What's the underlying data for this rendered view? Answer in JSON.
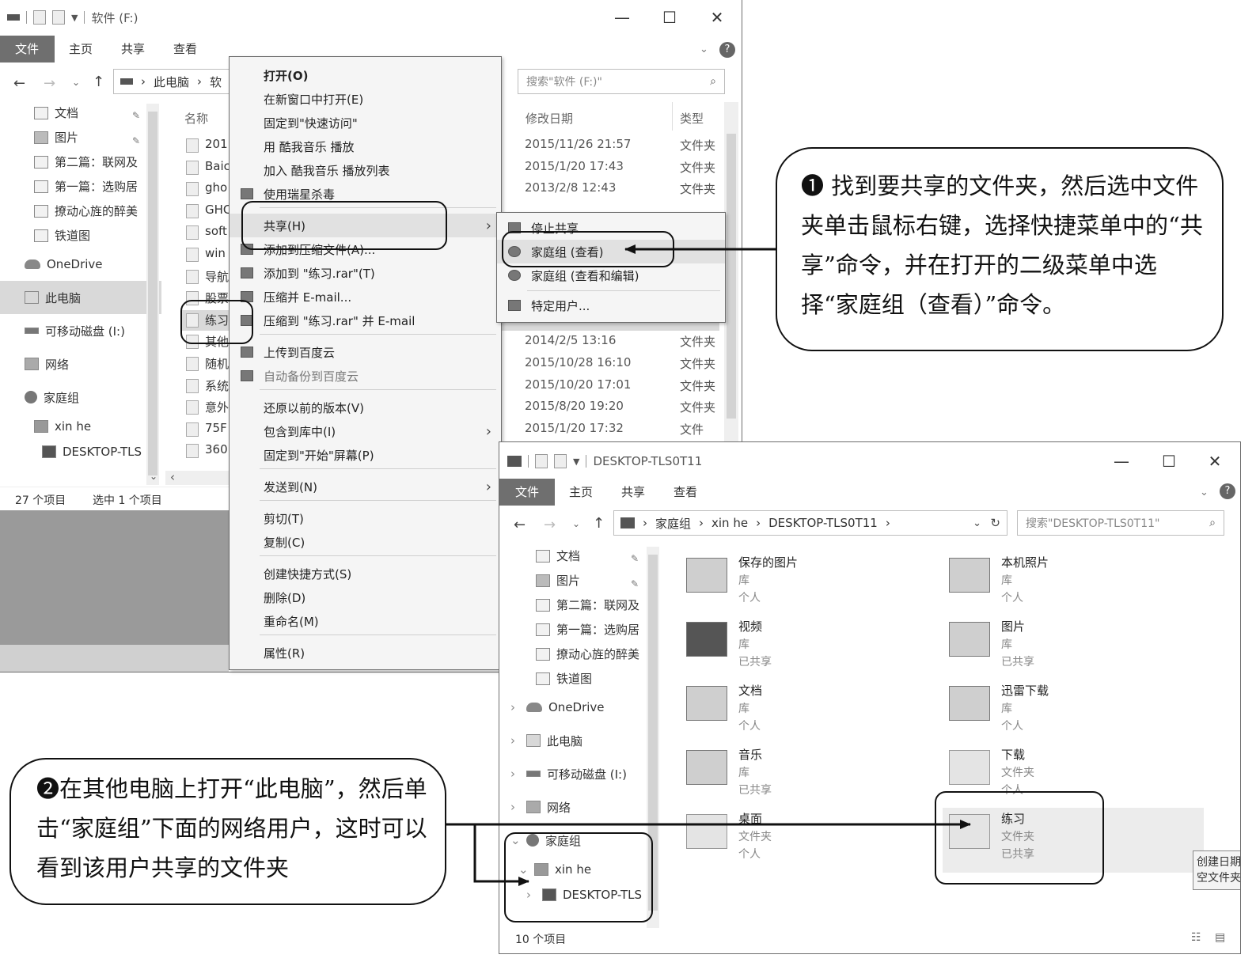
{
  "window1": {
    "title": "软件 (F:)",
    "tabs": [
      "文件",
      "主页",
      "共享",
      "查看"
    ],
    "address": [
      "此电脑",
      "软"
    ],
    "search_placeholder": "搜索\"软件 (F:)\"",
    "nav": [
      "文档",
      "图片",
      "第二篇：联网及",
      "第一篇：选购居",
      "撩动心旌的醉美",
      "铁道图",
      "OneDrive",
      "此电脑",
      "可移动磁盘 (I:)",
      "网络",
      "家庭组",
      "xin he",
      "DESKTOP-TLS"
    ],
    "columns": {
      "name": "名称",
      "modified": "修改日期",
      "type": "类型"
    },
    "files": [
      {
        "name": "201",
        "date": "2015/11/26 21:57",
        "type": "文件夹"
      },
      {
        "name": "Baic",
        "date": "2015/1/20 17:43",
        "type": "文件夹"
      },
      {
        "name": "gho",
        "date": "2013/2/8 12:43",
        "type": "文件夹"
      },
      {
        "name": "GHC",
        "date": "",
        "type": ""
      },
      {
        "name": "soft",
        "date": "",
        "type": ""
      },
      {
        "name": "win",
        "date": "",
        "type": ""
      },
      {
        "name": "导航",
        "date": "",
        "type": ""
      },
      {
        "name": "股票",
        "date": "",
        "type": ""
      },
      {
        "name": "练习",
        "date": "",
        "type": ""
      },
      {
        "name": "其他",
        "date": "2014/2/5 13:16",
        "type": "文件夹"
      },
      {
        "name": "随机",
        "date": "2015/10/28 16:10",
        "type": "文件夹"
      },
      {
        "name": "系统",
        "date": "2015/10/20 17:01",
        "type": "文件夹"
      },
      {
        "name": "意外",
        "date": "2015/8/20 19:20",
        "type": "文件夹"
      },
      {
        "name": "75F",
        "date": "2015/1/20 17:32",
        "type": "文件"
      },
      {
        "name": "360",
        "date": "",
        "type": ""
      }
    ],
    "status_count": "27 个项目",
    "status_selected": "选中 1 个项目"
  },
  "context_menu": {
    "items": [
      {
        "label": "打开(O)",
        "bold": true
      },
      {
        "label": "在新窗口中打开(E)"
      },
      {
        "label": "固定到\"快速访问\""
      },
      {
        "label": "用 酷我音乐 播放"
      },
      {
        "label": "加入 酷我音乐 播放列表"
      },
      {
        "label": "使用瑞星杀毒"
      },
      {
        "label": "共享(H)"
      },
      {
        "label": "添加到压缩文件(A)..."
      },
      {
        "label": "添加到 \"练习.rar\"(T)"
      },
      {
        "label": "压缩并 E-mail..."
      },
      {
        "label": "压缩到 \"练习.rar\" 并 E-mail"
      },
      {
        "label": "上传到百度云"
      },
      {
        "label": "自动备份到百度云"
      },
      {
        "label": "还原以前的版本(V)"
      },
      {
        "label": "包含到库中(I)"
      },
      {
        "label": "固定到\"开始\"屏幕(P)"
      },
      {
        "label": "发送到(N)"
      },
      {
        "label": "剪切(T)"
      },
      {
        "label": "复制(C)"
      },
      {
        "label": "创建快捷方式(S)"
      },
      {
        "label": "删除(D)"
      },
      {
        "label": "重命名(M)"
      },
      {
        "label": "属性(R)"
      }
    ]
  },
  "submenu": {
    "items": [
      "停止共享",
      "家庭组 (查看)",
      "家庭组 (查看和编辑)",
      "特定用户..."
    ]
  },
  "window2": {
    "title": "DESKTOP-TLS0T11",
    "tabs": [
      "文件",
      "主页",
      "共享",
      "查看"
    ],
    "address": [
      "家庭组",
      "xin he",
      "DESKTOP-TLS0T11"
    ],
    "search_placeholder": "搜索\"DESKTOP-TLS0T11\"",
    "nav": [
      "文档",
      "图片",
      "第二篇：联网及",
      "第一篇：选购居",
      "撩动心旌的醉美",
      "铁道图",
      "OneDrive",
      "此电脑",
      "可移动磁盘 (I:)",
      "网络",
      "家庭组",
      "xin he",
      "DESKTOP-TLS"
    ],
    "items": [
      {
        "name": "保存的图片",
        "l1": "库",
        "l2": "个人"
      },
      {
        "name": "本机照片",
        "l1": "库",
        "l2": "个人"
      },
      {
        "name": "视频",
        "l1": "库",
        "l2": "已共享"
      },
      {
        "name": "图片",
        "l1": "库",
        "l2": "已共享"
      },
      {
        "name": "文档",
        "l1": "库",
        "l2": "个人"
      },
      {
        "name": "迅雷下载",
        "l1": "库",
        "l2": "个人"
      },
      {
        "name": "音乐",
        "l1": "库",
        "l2": "已共享"
      },
      {
        "name": "下载",
        "l1": "文件夹",
        "l2": "个人"
      },
      {
        "name": "桌面",
        "l1": "文件夹",
        "l2": "个人"
      },
      {
        "name": "练习",
        "l1": "文件夹",
        "l2": "已共享"
      }
    ],
    "tooltip": [
      "创建日期",
      "空文件夹"
    ],
    "status_count": "10 个项目"
  },
  "callout1": "❶ 找到要共享的文件夹，然后选中文件夹单击鼠标右键，选择快捷菜单中的“共享”命令，并在打开的二级菜单中选择“家庭组（查看）”命令。",
  "callout2": "❷在其他电脑上打开“此电脑”，然后单击“家庭组”下面的网络用户，这时可以看到该用户共享的文件夹"
}
